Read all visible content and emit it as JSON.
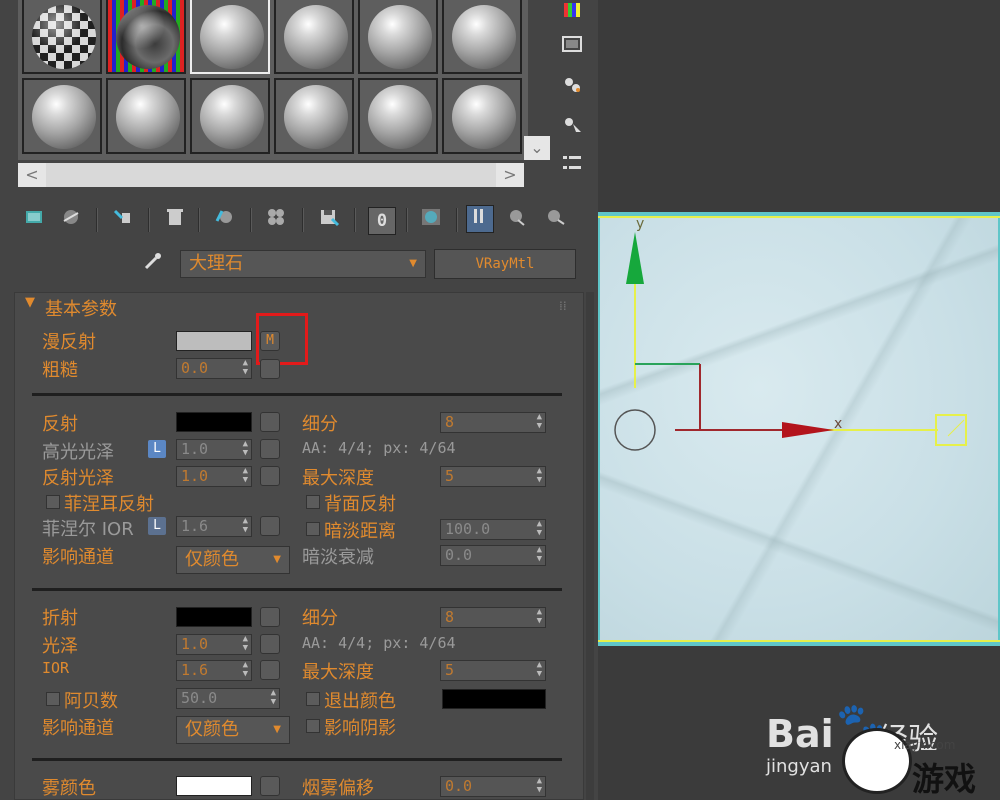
{
  "material_editor": {
    "preview_slots": [
      {
        "kind": "checker"
      },
      {
        "kind": "marble"
      },
      {
        "kind": "plain"
      },
      {
        "kind": "plain"
      },
      {
        "kind": "plain"
      },
      {
        "kind": "plain"
      },
      {
        "kind": "plain"
      },
      {
        "kind": "plain"
      },
      {
        "kind": "plain"
      },
      {
        "kind": "plain"
      },
      {
        "kind": "plain"
      },
      {
        "kind": "plain"
      }
    ],
    "toolbar_icons": [
      "get-material-icon",
      "put-to-scene-icon",
      "assign-material-icon",
      "delete-icon",
      "copy-material-icon",
      "make-unique-icon",
      "save-to-library-icon",
      "material-id-icon",
      "show-map-icon",
      "show-end-result-icon",
      "go-to-parent-icon",
      "go-forward-icon"
    ],
    "toolbar_id_value": "0",
    "side_tools": [
      "color-bars-icon",
      "render-map-icon",
      "sample-uv-icon",
      "select-by-material-icon",
      "options-list-icon"
    ],
    "material_name": "大理石",
    "material_type": "VRayMtl"
  },
  "basic_params": {
    "title": "基本参数",
    "diffuse_label": "漫反射",
    "diffuse_color": "#bdbdbd",
    "diffuse_map_button": "M",
    "roughness_label": "粗糙",
    "roughness_value": "0.0"
  },
  "reflection": {
    "reflect_label": "反射",
    "reflect_color": "#000000",
    "hilight_gloss_label": "高光光泽",
    "hilight_gloss_value": "1.0",
    "refl_gloss_label": "反射光泽",
    "refl_gloss_value": "1.0",
    "fresnel_label": "菲涅耳反射",
    "fresnel_ior_label": "菲涅尔 IOR",
    "fresnel_ior_value": "1.6",
    "affect_channels_label": "影响通道",
    "affect_channels_value": "仅颜色",
    "subdivs_label": "细分",
    "subdivs_value": "8",
    "aa_text": "AA: 4/4; px: 4/64",
    "max_depth_label": "最大深度",
    "max_depth_value": "5",
    "back_reflect_label": "背面反射",
    "dim_distance_label": "暗淡距离",
    "dim_distance_value": "100.0",
    "dim_falloff_label": "暗淡衰减",
    "dim_falloff_value": "0.0",
    "L": "L"
  },
  "refraction": {
    "refract_label": "折射",
    "refract_color": "#000000",
    "gloss_label": "光泽",
    "gloss_value": "1.0",
    "ior_label": "IOR",
    "ior_value": "1.6",
    "abbe_label": "阿贝数",
    "abbe_value": "50.0",
    "affect_channels_label": "影响通道",
    "affect_channels_value": "仅颜色",
    "subdivs_label": "细分",
    "subdivs_value": "8",
    "aa_text": "AA: 4/4; px: 4/64",
    "max_depth_label": "最大深度",
    "max_depth_value": "5",
    "exit_color_label": "退出颜色",
    "exit_color": "#000000",
    "affect_shadows_label": "影响阴影"
  },
  "fog": {
    "fog_color_label": "雾颜色",
    "fog_color": "#ffffff",
    "fog_bias_label": "烟雾偏移",
    "fog_bias_value": "0.0"
  },
  "viewport": {
    "axis_y": "y",
    "axis_x": "x",
    "surface_color": "#c9dfe6"
  },
  "watermark": {
    "text1": "Bai",
    "text2": "经验",
    "text3": "jingyan",
    "text4": "游戏",
    "text5": "xiayx.com"
  }
}
